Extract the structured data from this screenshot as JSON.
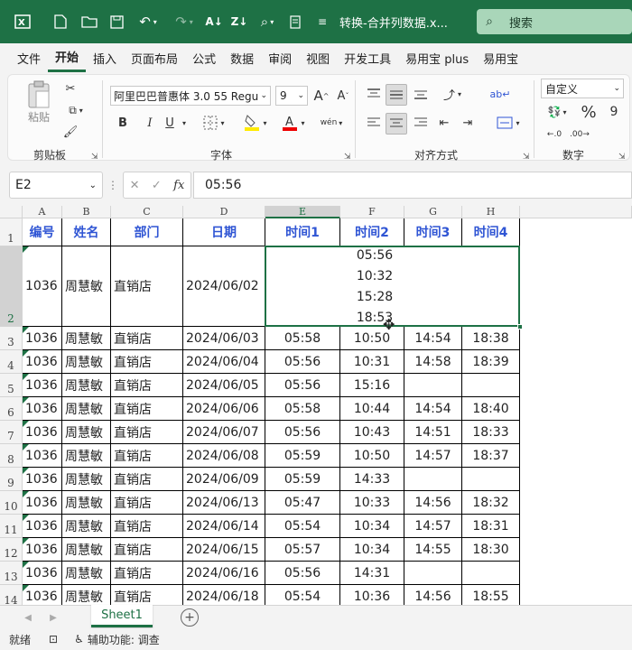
{
  "titlebar": {
    "filename": "转换-合并列数据.x...",
    "search_placeholder": "搜索"
  },
  "menu": {
    "tabs": [
      "文件",
      "开始",
      "插入",
      "页面布局",
      "公式",
      "数据",
      "审阅",
      "视图",
      "开发工具",
      "易用宝 plus",
      "易用宝"
    ]
  },
  "ribbon": {
    "clipboard": {
      "paste_label": "粘贴",
      "group_label": "剪贴板"
    },
    "font": {
      "font_name": "阿里巴巴普惠体 3.0 55 Regu",
      "font_size": "9",
      "bold": "B",
      "italic": "I",
      "underline": "U",
      "increase": "A",
      "decrease": "A",
      "group_label": "字体"
    },
    "alignment": {
      "group_label": "对齐方式"
    },
    "number": {
      "format": "自定义",
      "percent": "%",
      "group_label": "数字"
    }
  },
  "formula_bar": {
    "cell_ref": "E2",
    "fx_label": "fx",
    "content": "05:56"
  },
  "grid": {
    "columns": [
      "A",
      "B",
      "C",
      "D",
      "E",
      "F",
      "G",
      "H"
    ],
    "headers": [
      "编号",
      "姓名",
      "部门",
      "日期",
      "时间1",
      "时间2",
      "时间3",
      "时间4"
    ],
    "row_numbers": [
      "1",
      "2",
      "3",
      "4",
      "5",
      "6",
      "7",
      "8",
      "9",
      "10",
      "11",
      "12",
      "13",
      "14"
    ],
    "merged_row": {
      "id": "1036",
      "name": "周慧敏",
      "dept": "直销店",
      "date": "2024/06/02",
      "times": [
        "05:56",
        "10:32",
        "15:28",
        "18:53"
      ]
    },
    "rows": [
      [
        "1036",
        "周慧敏",
        "直销店",
        "2024/06/03",
        "05:58",
        "10:50",
        "14:54",
        "18:38"
      ],
      [
        "1036",
        "周慧敏",
        "直销店",
        "2024/06/04",
        "05:56",
        "10:31",
        "14:58",
        "18:39"
      ],
      [
        "1036",
        "周慧敏",
        "直销店",
        "2024/06/05",
        "05:56",
        "15:16",
        "",
        ""
      ],
      [
        "1036",
        "周慧敏",
        "直销店",
        "2024/06/06",
        "05:58",
        "10:44",
        "14:54",
        "18:40"
      ],
      [
        "1036",
        "周慧敏",
        "直销店",
        "2024/06/07",
        "05:56",
        "10:43",
        "14:51",
        "18:33"
      ],
      [
        "1036",
        "周慧敏",
        "直销店",
        "2024/06/08",
        "05:59",
        "10:50",
        "14:57",
        "18:37"
      ],
      [
        "1036",
        "周慧敏",
        "直销店",
        "2024/06/09",
        "05:59",
        "14:33",
        "",
        ""
      ],
      [
        "1036",
        "周慧敏",
        "直销店",
        "2024/06/13",
        "05:47",
        "10:33",
        "14:56",
        "18:32"
      ],
      [
        "1036",
        "周慧敏",
        "直销店",
        "2024/06/14",
        "05:54",
        "10:34",
        "14:57",
        "18:31"
      ],
      [
        "1036",
        "周慧敏",
        "直销店",
        "2024/06/15",
        "05:57",
        "10:34",
        "14:55",
        "18:30"
      ],
      [
        "1036",
        "周慧敏",
        "直销店",
        "2024/06/16",
        "05:56",
        "14:31",
        "",
        ""
      ],
      [
        "1036",
        "周慧敏",
        "直销店",
        "2024/06/18",
        "05:54",
        "10:36",
        "14:56",
        "18:55"
      ]
    ]
  },
  "sheets": {
    "active": "Sheet1"
  },
  "status": {
    "ready": "就绪",
    "accessibility": "辅助功能: 调查"
  },
  "colors": {
    "accent": "#1e7145",
    "header_text": "#2f55d4"
  }
}
